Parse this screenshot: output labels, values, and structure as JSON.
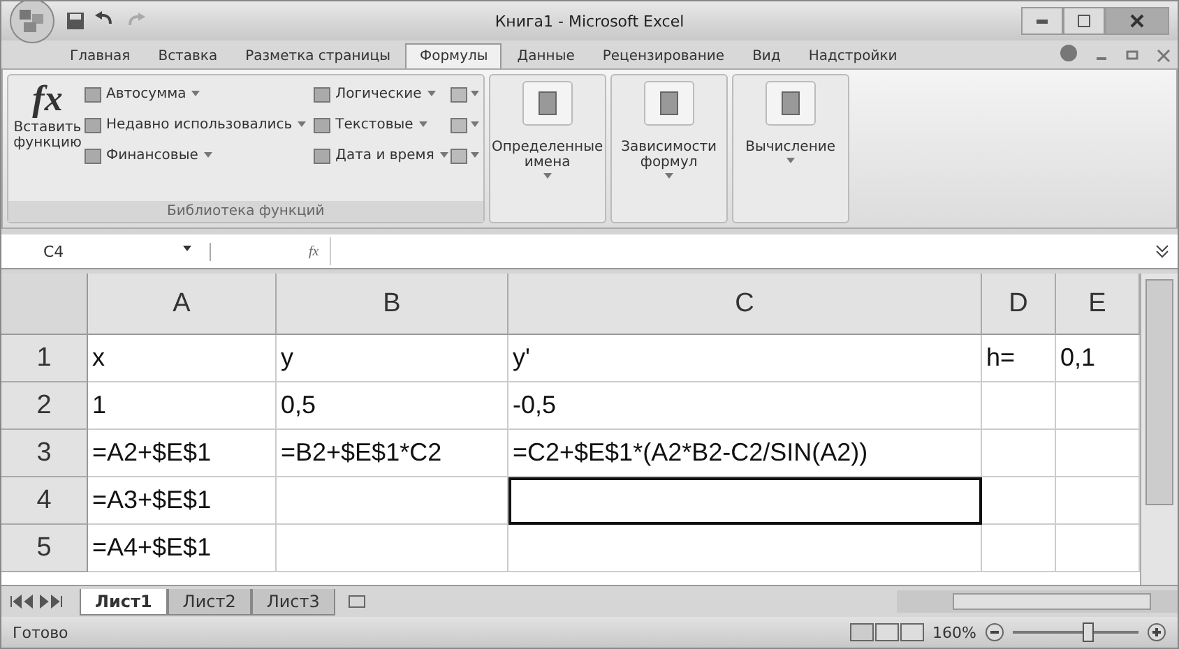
{
  "window": {
    "title": "Книга1 - Microsoft Excel"
  },
  "tabs": [
    {
      "label": "Главная",
      "selected": false
    },
    {
      "label": "Вставка",
      "selected": false
    },
    {
      "label": "Разметка страницы",
      "selected": false
    },
    {
      "label": "Формулы",
      "selected": true
    },
    {
      "label": "Данные",
      "selected": false
    },
    {
      "label": "Рецензирование",
      "selected": false
    },
    {
      "label": "Вид",
      "selected": false
    },
    {
      "label": "Надстройки",
      "selected": false
    }
  ],
  "ribbon": {
    "insert_function": {
      "glyph": "fx",
      "label": "Вставить функцию"
    },
    "library_items": [
      {
        "label": "Автосумма"
      },
      {
        "label": "Недавно использовались"
      },
      {
        "label": "Финансовые"
      },
      {
        "label": "Логические"
      },
      {
        "label": "Текстовые"
      },
      {
        "label": "Дата и время"
      }
    ],
    "library_label": "Библиотека функций",
    "large_buttons": [
      {
        "label": "Определенные имена"
      },
      {
        "label": "Зависимости формул"
      },
      {
        "label": "Вычисление"
      }
    ]
  },
  "formula_bar": {
    "name_box": "C4",
    "fx": "fx"
  },
  "sheet": {
    "columns": [
      "A",
      "B",
      "C",
      "D",
      "E"
    ],
    "rows": [
      {
        "number": "1",
        "cells": [
          {
            "text": "x",
            "selected": false
          },
          {
            "text": "y",
            "selected": false
          },
          {
            "text": "y'",
            "selected": false
          },
          {
            "text": "h=",
            "selected": false
          },
          {
            "text": "0,1",
            "selected": false
          }
        ]
      },
      {
        "number": "2",
        "cells": [
          {
            "text": "1",
            "selected": false
          },
          {
            "text": "0,5",
            "selected": false
          },
          {
            "text": "-0,5",
            "selected": false
          },
          {
            "text": "",
            "selected": false
          },
          {
            "text": "",
            "selected": false
          }
        ]
      },
      {
        "number": "3",
        "cells": [
          {
            "text": "=A2+$E$1",
            "selected": false
          },
          {
            "text": "=B2+$E$1*C2",
            "selected": false
          },
          {
            "text": "=C2+$E$1*(A2*B2-C2/SIN(A2))",
            "selected": false
          },
          {
            "text": "",
            "selected": false
          },
          {
            "text": "",
            "selected": false
          }
        ]
      },
      {
        "number": "4",
        "cells": [
          {
            "text": "=A3+$E$1",
            "selected": false
          },
          {
            "text": "",
            "selected": false
          },
          {
            "text": "",
            "selected": true
          },
          {
            "text": "",
            "selected": false
          },
          {
            "text": "",
            "selected": false
          }
        ]
      },
      {
        "number": "5",
        "cells": [
          {
            "text": "=A4+$E$1",
            "selected": false
          },
          {
            "text": "",
            "selected": false
          },
          {
            "text": "",
            "selected": false
          },
          {
            "text": "",
            "selected": false
          },
          {
            "text": "",
            "selected": false
          }
        ]
      }
    ]
  },
  "sheet_tabs": [
    {
      "label": "Лист1",
      "selected": true
    },
    {
      "label": "Лист2",
      "selected": false
    },
    {
      "label": "Лист3",
      "selected": false
    }
  ],
  "status_bar": {
    "text": "Готово",
    "zoom": "160%",
    "level": 0.6
  }
}
